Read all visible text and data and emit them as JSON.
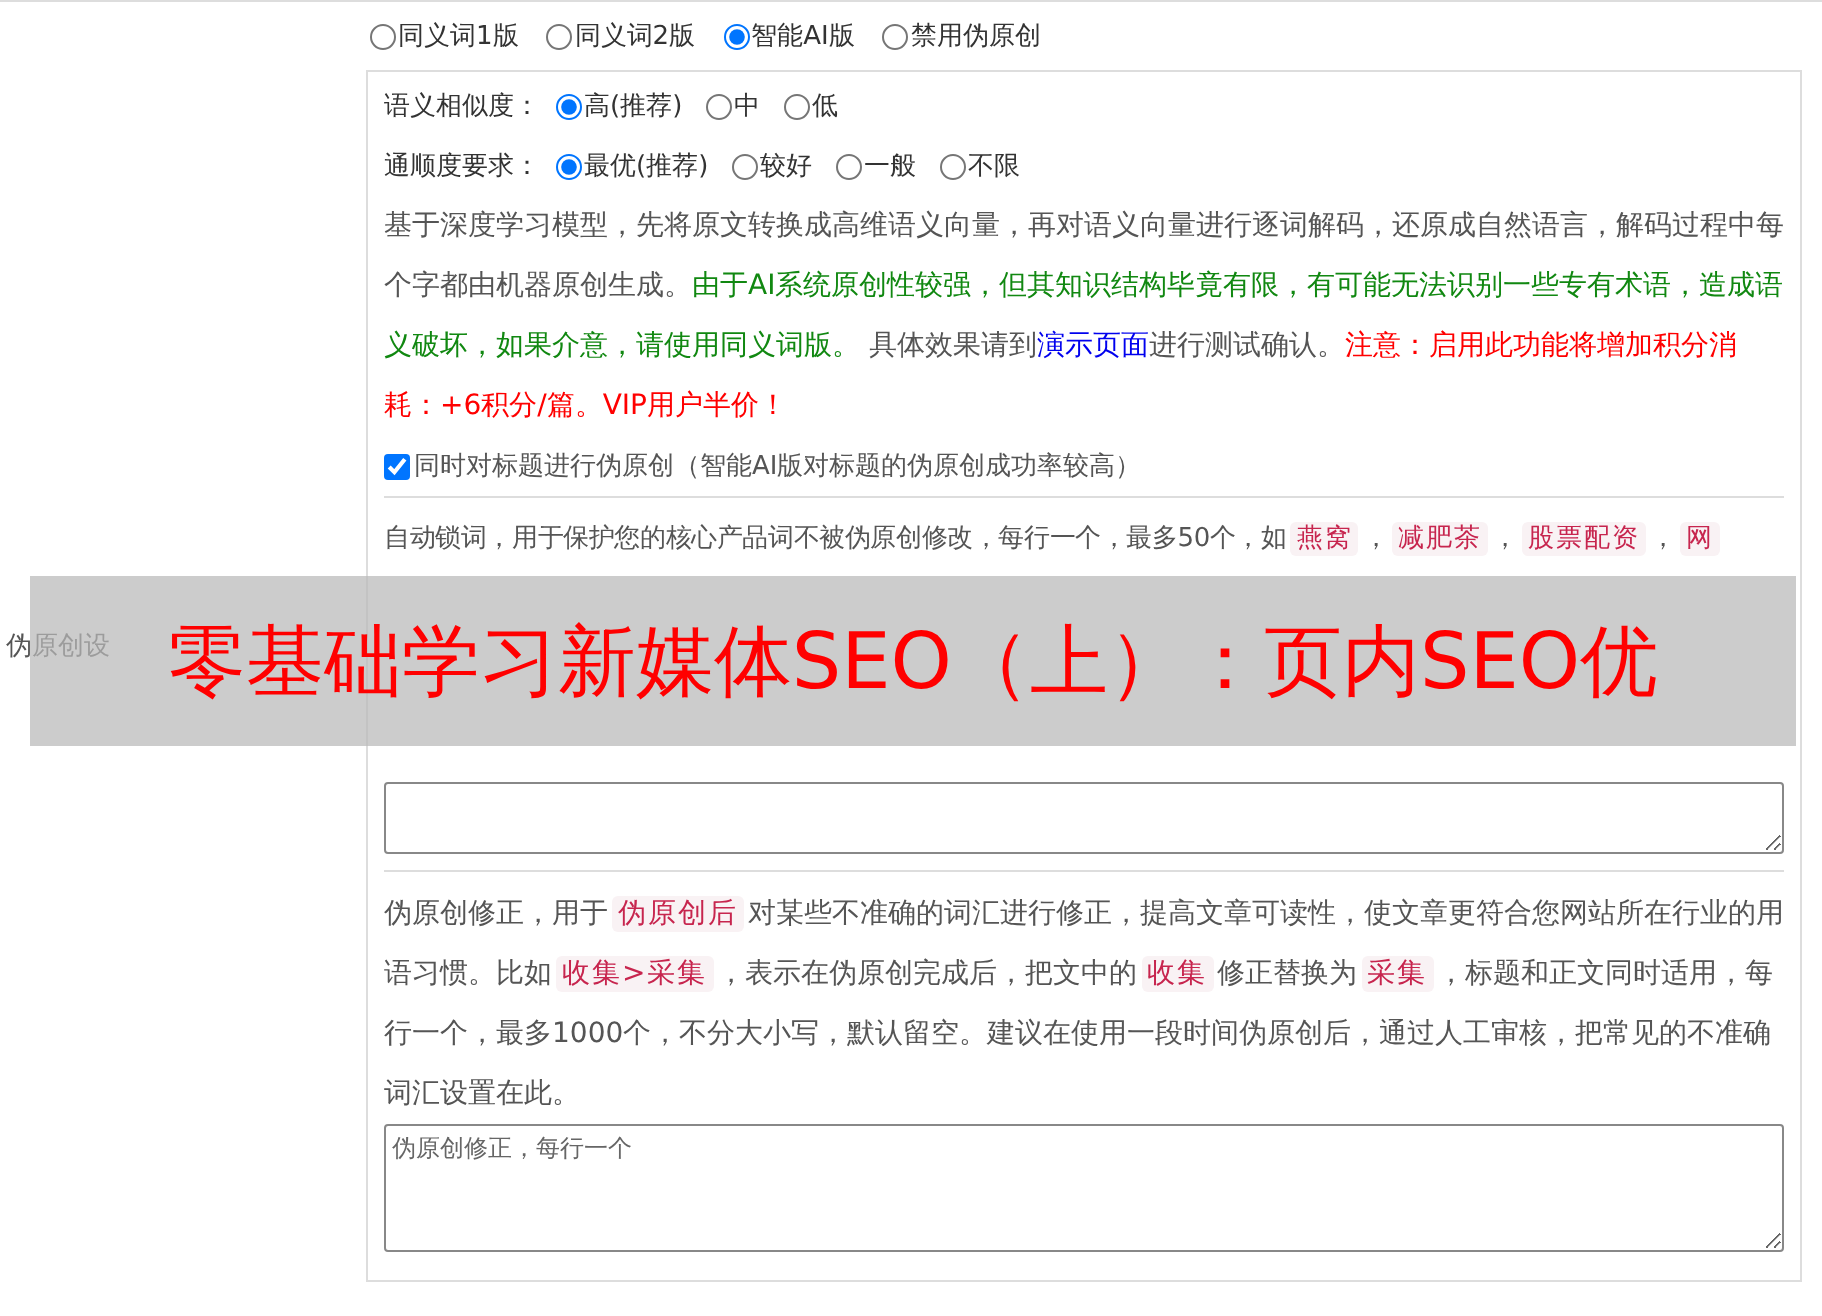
{
  "mode_options": [
    {
      "label": "同义词1版",
      "selected": false
    },
    {
      "label": "同义词2版",
      "selected": false
    },
    {
      "label": "智能AI版",
      "selected": true
    },
    {
      "label": "禁用伪原创",
      "selected": false
    }
  ],
  "similarity": {
    "label": "语义相似度：",
    "options": [
      {
        "label": "高(推荐)",
        "selected": true
      },
      {
        "label": "中",
        "selected": false
      },
      {
        "label": "低",
        "selected": false
      }
    ]
  },
  "fluency": {
    "label": "通顺度要求：",
    "options": [
      {
        "label": "最优(推荐)",
        "selected": true
      },
      {
        "label": "较好",
        "selected": false
      },
      {
        "label": "一般",
        "selected": false
      },
      {
        "label": "不限",
        "selected": false
      }
    ]
  },
  "description": [
    {
      "kind": "plain",
      "text": "基于深度学习模型，先将原文转换成高维语义向量，再对语义向量进行逐词解码，还原成自然语言，解码过程中每个字都由机器原创生成。"
    },
    {
      "kind": "green",
      "text": "由于AI系统原创性较强，但其知识结构毕竟有限，有可能无法识别一些专有术语，造成语义破坏，如果介意，请使用同义词版。"
    },
    {
      "kind": "plain",
      "text": "具体效果请到"
    },
    {
      "kind": "link",
      "text": "演示页面"
    },
    {
      "kind": "plain",
      "text": "进行测试确认。"
    },
    {
      "kind": "red",
      "text": "注意：启用此功能将增加积分消耗：+6积分/篇。VIP用户半价！"
    }
  ],
  "title_checkbox": {
    "label": "同时对标题进行伪原创（智能AI版对标题的伪原创成功率较高）",
    "checked": true
  },
  "side_label": "伪原创设",
  "lock_text": [
    {
      "kind": "plain",
      "text": "自动锁词，用于保护您的核心产品词不被伪原创修改，每行一个，最多50个，如"
    },
    {
      "kind": "chip",
      "text": "燕窝"
    },
    {
      "kind": "plain",
      "text": "，"
    },
    {
      "kind": "chip",
      "text": "减肥茶"
    },
    {
      "kind": "plain",
      "text": "，"
    },
    {
      "kind": "chip",
      "text": "股票配资"
    },
    {
      "kind": "plain",
      "text": "，"
    },
    {
      "kind": "chip",
      "text": "网"
    }
  ],
  "correction_text": [
    {
      "kind": "plain",
      "text": "伪原创修正，用于"
    },
    {
      "kind": "chip",
      "text": "伪原创后"
    },
    {
      "kind": "plain",
      "text": "对某些不准确的词汇进行修正，提高文章可读性，使文章更符合您网站所在行业的用语习惯。比如"
    },
    {
      "kind": "chip",
      "text": "收集>采集"
    },
    {
      "kind": "plain",
      "text": "，表示在伪原创完成后，把文中的"
    },
    {
      "kind": "chip",
      "text": "收集"
    },
    {
      "kind": "plain",
      "text": "修正替换为"
    },
    {
      "kind": "chip",
      "text": "采集"
    },
    {
      "kind": "plain",
      "text": "，标题和正文同时适用，每行一个，最多1000个，不分大小写，默认留空。建议在使用一段时间伪原创后，通过人工审核，把常见的不准确词汇设置在此。"
    }
  ],
  "correction_placeholder": "伪原创修正，每行一个",
  "banner": "零基础学习新媒体SEO（上）：页内SEO优"
}
